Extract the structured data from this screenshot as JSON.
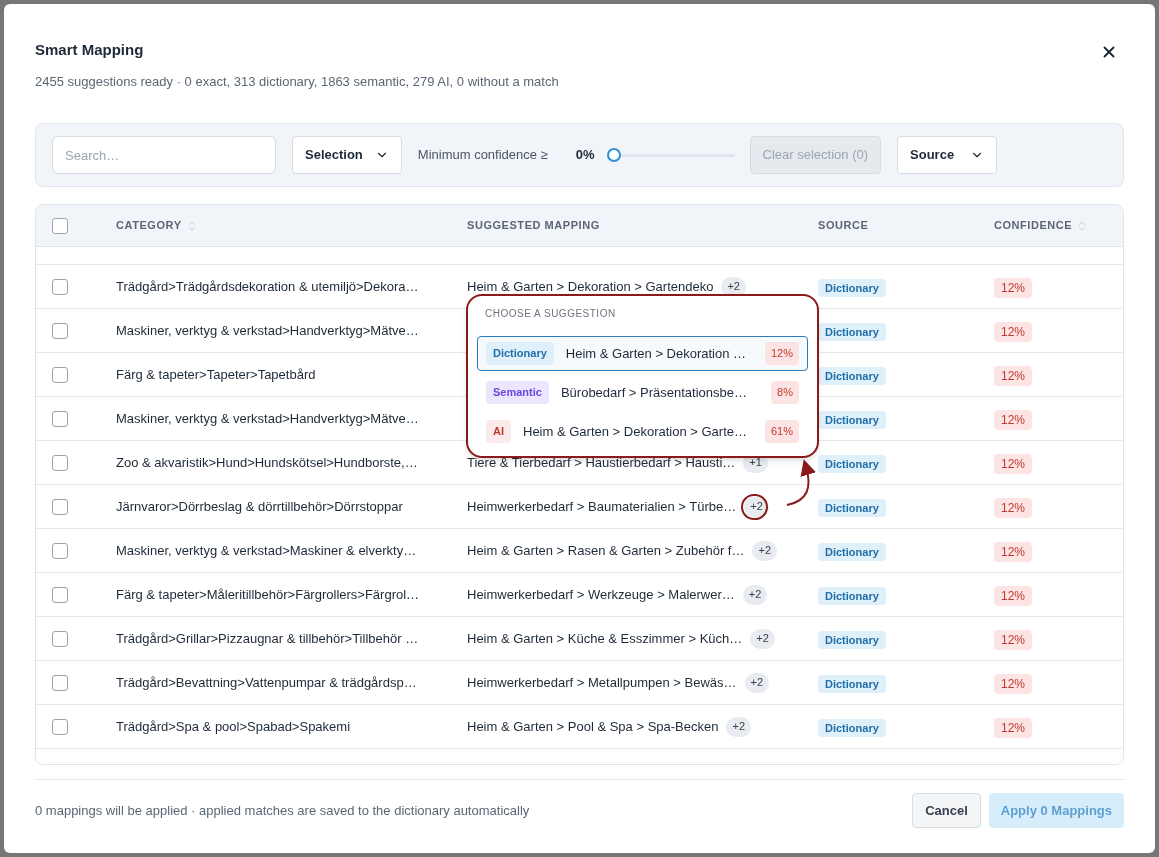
{
  "dialog": {
    "title": "Smart Mapping",
    "subtitle": "2455 suggestions ready · 0 exact, 313 dictionary, 1863 semantic, 279 AI, 0 without a match"
  },
  "toolbar": {
    "search": {
      "placeholder": "Search…"
    },
    "selection_dropdown": "Selection",
    "confidence": {
      "label": "Minimum confidence ≥",
      "reading": "0%",
      "level": 0
    },
    "clear_button": {
      "label": "Clear selection (0)",
      "disabled": true
    },
    "source_dropdown": "Source"
  },
  "table": {
    "header_checkbox": {
      "checked": false
    },
    "columns": [
      {
        "label": "CATEGORY",
        "sortable": true
      },
      {
        "label": "SUGGESTED MAPPING",
        "sortable": false
      },
      {
        "label": "SOURCE",
        "sortable": false
      },
      {
        "label": "CONFIDENCE",
        "sortable": true
      }
    ],
    "rows": [
      {
        "checked": false,
        "category": "Trädgård>Trädgårdsdekoration & utemiljö>Dekora…",
        "mapping": "Heim & Garten > Dekoration > Gartendeko",
        "more": "+2",
        "highlighted": false,
        "source": "Dictionary",
        "confidence": "12%"
      },
      {
        "checked": false,
        "category": "Maskiner, verktyg & verkstad>Handverktyg>Mätve…",
        "highlighted": false,
        "source": "Dictionary",
        "confidence": "12%"
      },
      {
        "checked": false,
        "category": "Färg & tapeter>Tapeter>Tapetbård",
        "highlighted": false,
        "source": "Dictionary",
        "confidence": "12%"
      },
      {
        "checked": false,
        "category": "Maskiner, verktyg & verkstad>Handverktyg>Mätve…",
        "highlighted": false,
        "source": "Dictionary",
        "confidence": "12%"
      },
      {
        "checked": false,
        "category": "Zoo & akvaristik>Hund>Hundskötsel>Hundborste,…",
        "mapping": "Tiere & Tierbedarf > Haustierbedarf > Hausti…",
        "more": "+1",
        "highlighted": false,
        "source": "Dictionary",
        "confidence": "12%"
      },
      {
        "checked": false,
        "category": "Järnvaror>Dörrbeslag & dörrtillbehör>Dörrstoppar",
        "mapping": "Heimwerkerbedarf > Baumaterialien > Türbe…",
        "more": "+2",
        "highlighted": true,
        "source": "Dictionary",
        "confidence": "12%"
      },
      {
        "checked": false,
        "category": "Maskiner, verktyg & verkstad>Maskiner & elverkty…",
        "mapping": "Heim & Garten > Rasen & Garten > Zubehör f…",
        "more": "+2",
        "highlighted": false,
        "source": "Dictionary",
        "confidence": "12%"
      },
      {
        "checked": false,
        "category": "Färg & tapeter>Måleritillbehör>Färgrollers>Färgrol…",
        "mapping": "Heimwerkerbedarf > Werkzeuge > Malerwer…",
        "more": "+2",
        "highlighted": false,
        "source": "Dictionary",
        "confidence": "12%"
      },
      {
        "checked": false,
        "category": "Trädgård>Grillar>Pizzaugnar & tillbehör>Tillbehör …",
        "mapping": "Heim & Garten > Küche & Esszimmer > Küch…",
        "more": "+2",
        "highlighted": false,
        "source": "Dictionary",
        "confidence": "12%"
      },
      {
        "checked": false,
        "category": "Trädgård>Bevattning>Vattenpumpar & trädgårdsp…",
        "mapping": "Heimwerkerbedarf > Metallpumpen > Bewäs…",
        "more": "+2",
        "highlighted": false,
        "source": "Dictionary",
        "confidence": "12%"
      },
      {
        "checked": false,
        "category": "Trädgård>Spa & pool>Spabad>Spakemi",
        "mapping": "Heim & Garten > Pool & Spa > Spa-Becken",
        "more": "+2",
        "highlighted": false,
        "source": "Dictionary",
        "confidence": "12%"
      }
    ]
  },
  "popover": {
    "title": "CHOOSE A SUGGESTION",
    "options": [
      {
        "kind": "dictionary",
        "source": "Dictionary",
        "mapping": "Heim & Garten > Dekoration …",
        "confidence": "12%",
        "selected": true
      },
      {
        "kind": "semantic",
        "source": "Semantic",
        "mapping": "Bürobedarf > Präsentationsbe…",
        "confidence": "8%",
        "selected": false
      },
      {
        "kind": "ai",
        "source": "AI",
        "mapping": "Heim & Garten > Dekoration > Garte…",
        "confidence": "61%",
        "selected": false
      }
    ]
  },
  "footer": {
    "note": "0 mappings will be applied · applied matches are saved to the dictionary automatically",
    "cancel": "Cancel",
    "apply": {
      "label": "Apply 0 Mappings",
      "disabled": true
    }
  }
}
